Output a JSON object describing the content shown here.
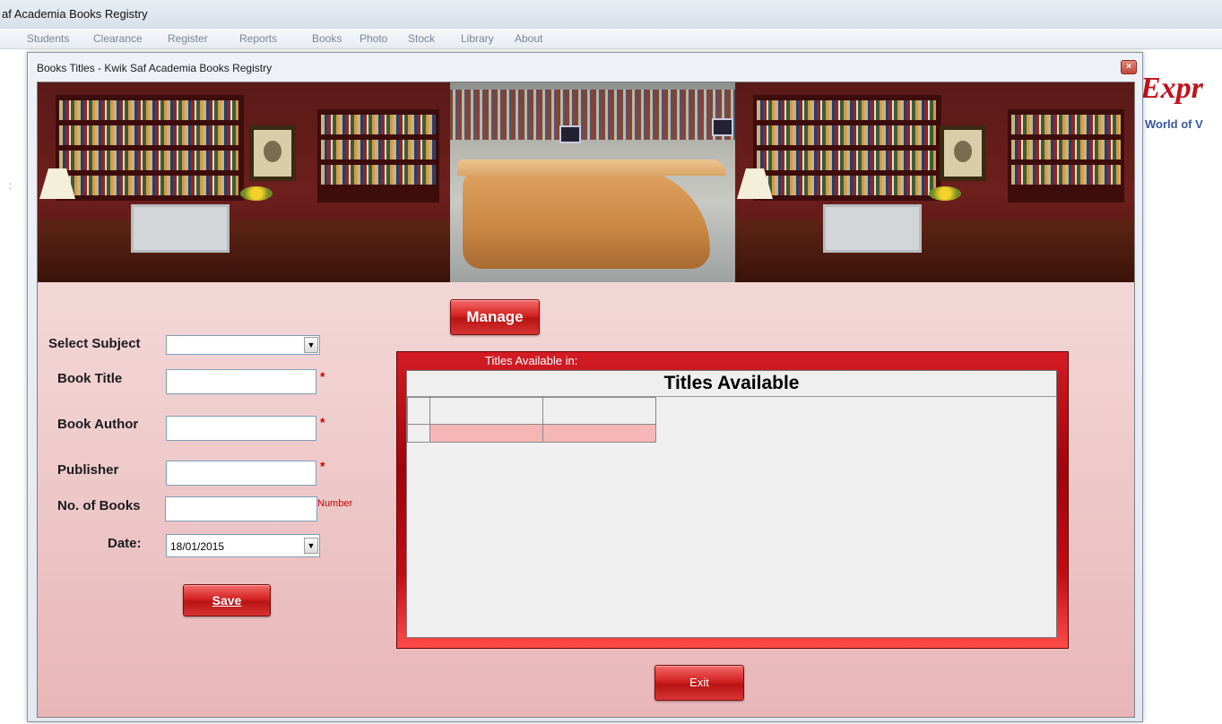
{
  "app": {
    "title": "af Academia Books Registry",
    "menu": [
      "Students",
      "Clearance",
      "Register",
      "Reports",
      "Books",
      "Photo",
      "Stock",
      "Library",
      "About"
    ],
    "logo_text": "Expr",
    "logo_tagline": "World of V",
    "accent_color": "#c1121b"
  },
  "dialog": {
    "title": "Books Titles - Kwik Saf Academia Books Registry",
    "close_label": "×"
  },
  "form": {
    "manage_label": "Manage",
    "subject_label": "Select Subject",
    "subject_value": "",
    "title_label": "Book Title",
    "title_value": "",
    "author_label": "Book Author",
    "author_value": "",
    "publisher_label": "Publisher",
    "publisher_value": "",
    "count_label": "No. of Books",
    "count_value": "",
    "count_hint": "Number",
    "required_mark": "*",
    "date_label": "Date:",
    "date_value": "18/01/2015",
    "save_label": "Save",
    "exit_label": "Exit"
  },
  "grid": {
    "caption": "Titles Available in:",
    "title": "Titles Available",
    "columns": [
      "",
      ""
    ],
    "rows": [
      [
        "",
        ""
      ]
    ]
  },
  "icons": {
    "dropdown": "▼"
  }
}
